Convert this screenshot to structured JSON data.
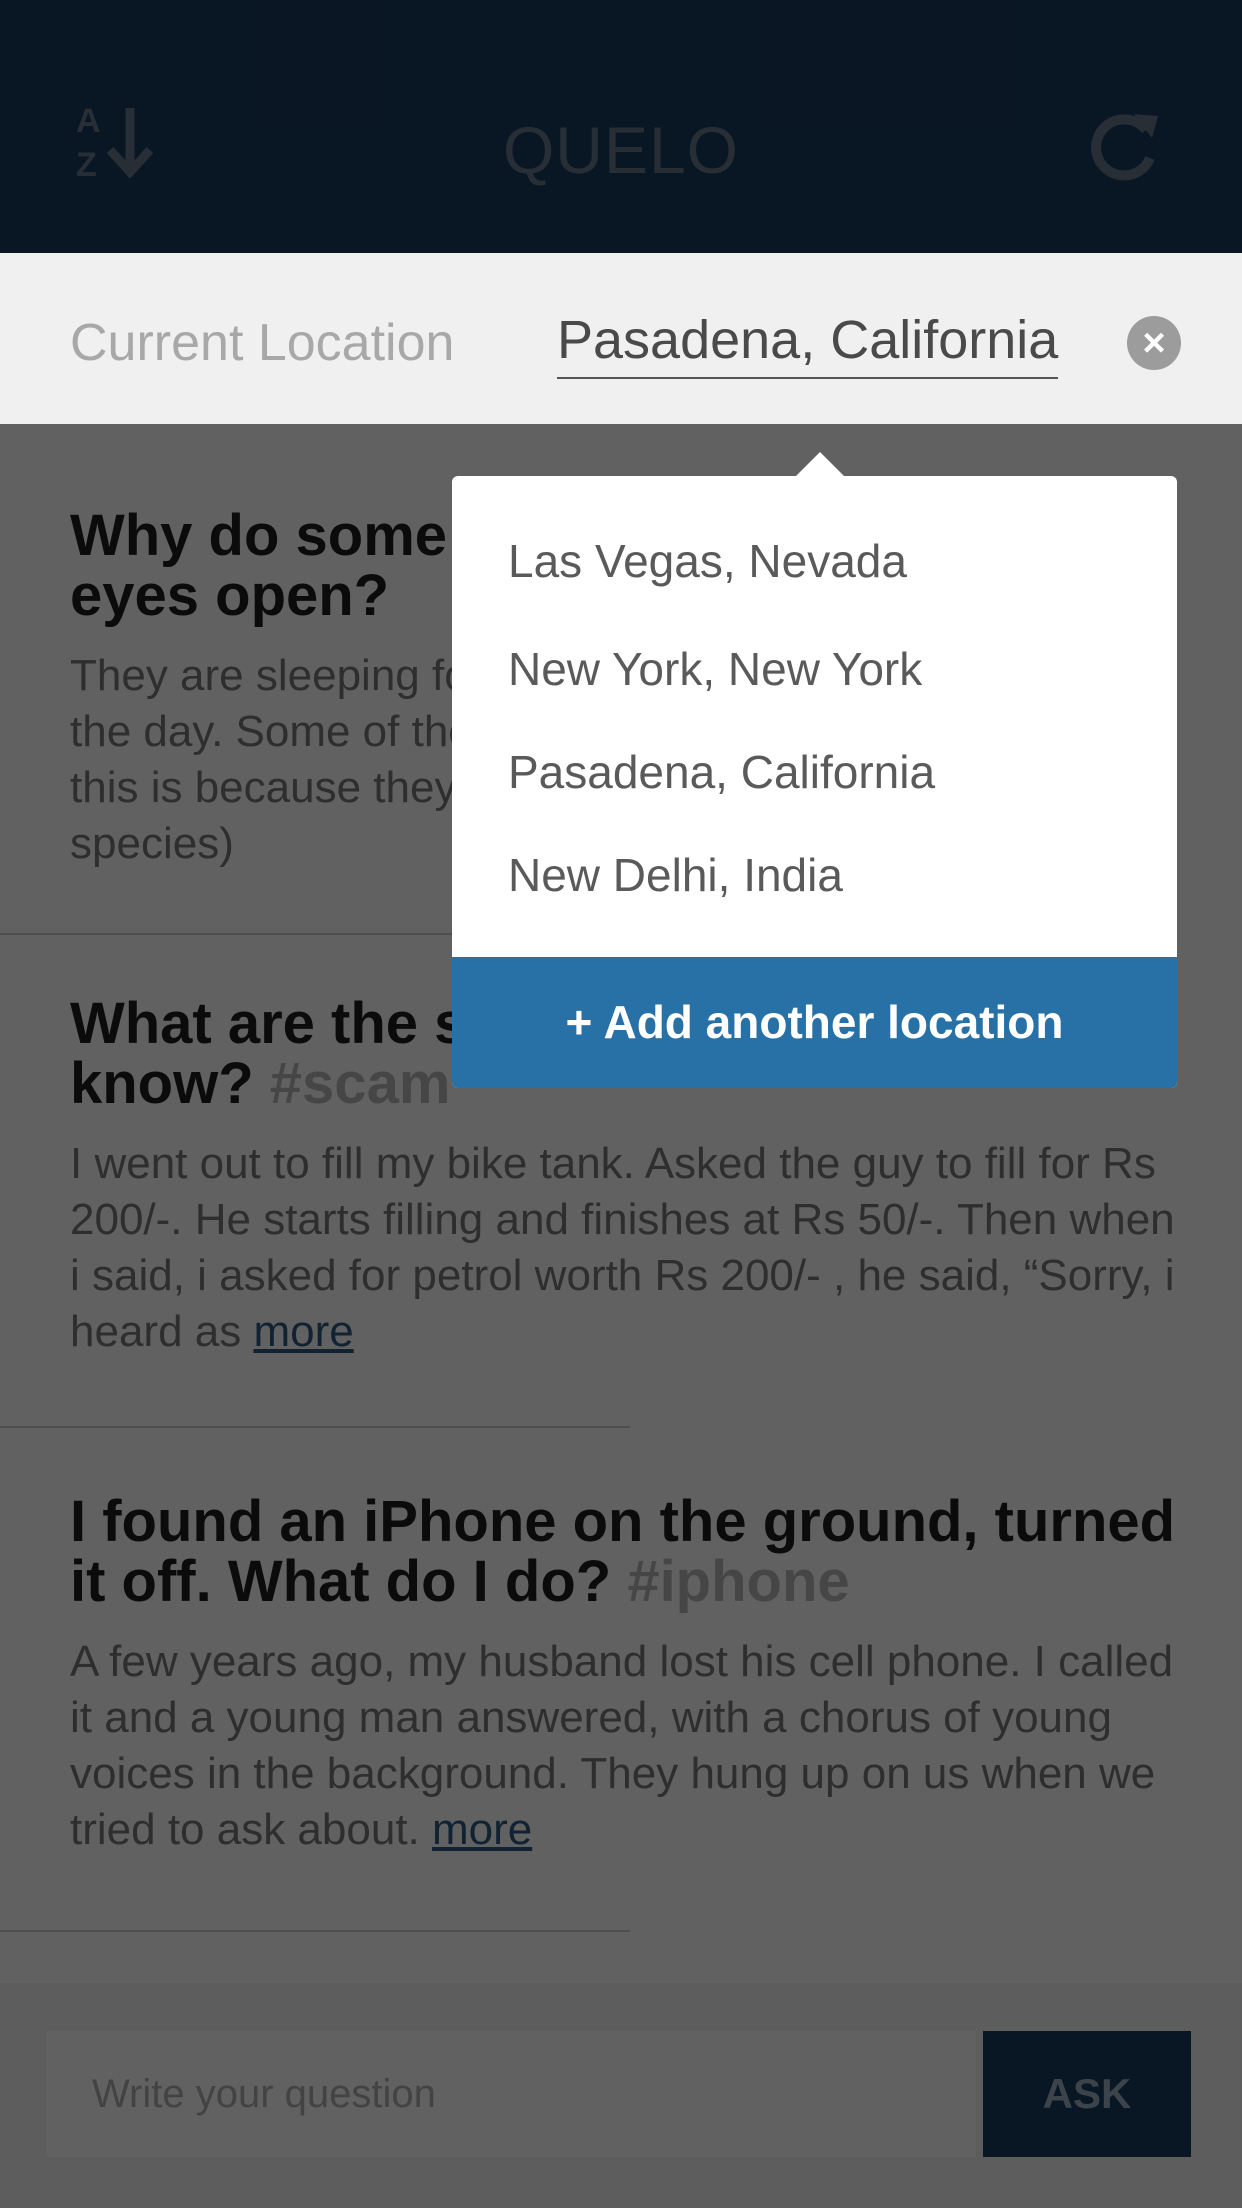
{
  "header": {
    "title": "QUELO",
    "sort_icon": "sort-alpha-icon",
    "refresh_icon": "refresh-icon",
    "background": "#1a3a5e"
  },
  "location": {
    "label": "Current Location",
    "value": "Pasadena, California",
    "clear_icon": "close-icon"
  },
  "dropdown": {
    "options": [
      "Las Vegas, Nevada",
      "New York, New York",
      "Pasadena, California",
      "New Delhi, India"
    ],
    "add_label": "+ Add another location",
    "add_color": "#2871a6"
  },
  "feed": [
    {
      "title": "Why do some animals sleep with their eyes open?",
      "tag": "",
      "body": "They are sleeping for only a short amount of time during the day. Some of them sleep with their eyes open, but this is because they lack eye lids (except for some species)"
    },
    {
      "title": "What are the scams everyone needs to know?",
      "tag": "#scam",
      "body": "I went out to fill my bike tank. Asked the guy to fill for Rs 200/-. He starts filling and finishes at Rs 50/-. Then when i said, i asked for petrol worth Rs 200/- , he said, “Sorry, i heard as",
      "more": "more"
    },
    {
      "title": "I found an iPhone on the ground, turned it off. What do I do?",
      "tag": "#iphone",
      "body": "A few years ago, my husband lost his cell phone. I called it and a young man answered, with a chorus of young voices in the background. They hung up on us when we tried to ask about.",
      "more": "more"
    }
  ],
  "ask": {
    "placeholder": "Write your question",
    "button_label": "ASK"
  }
}
